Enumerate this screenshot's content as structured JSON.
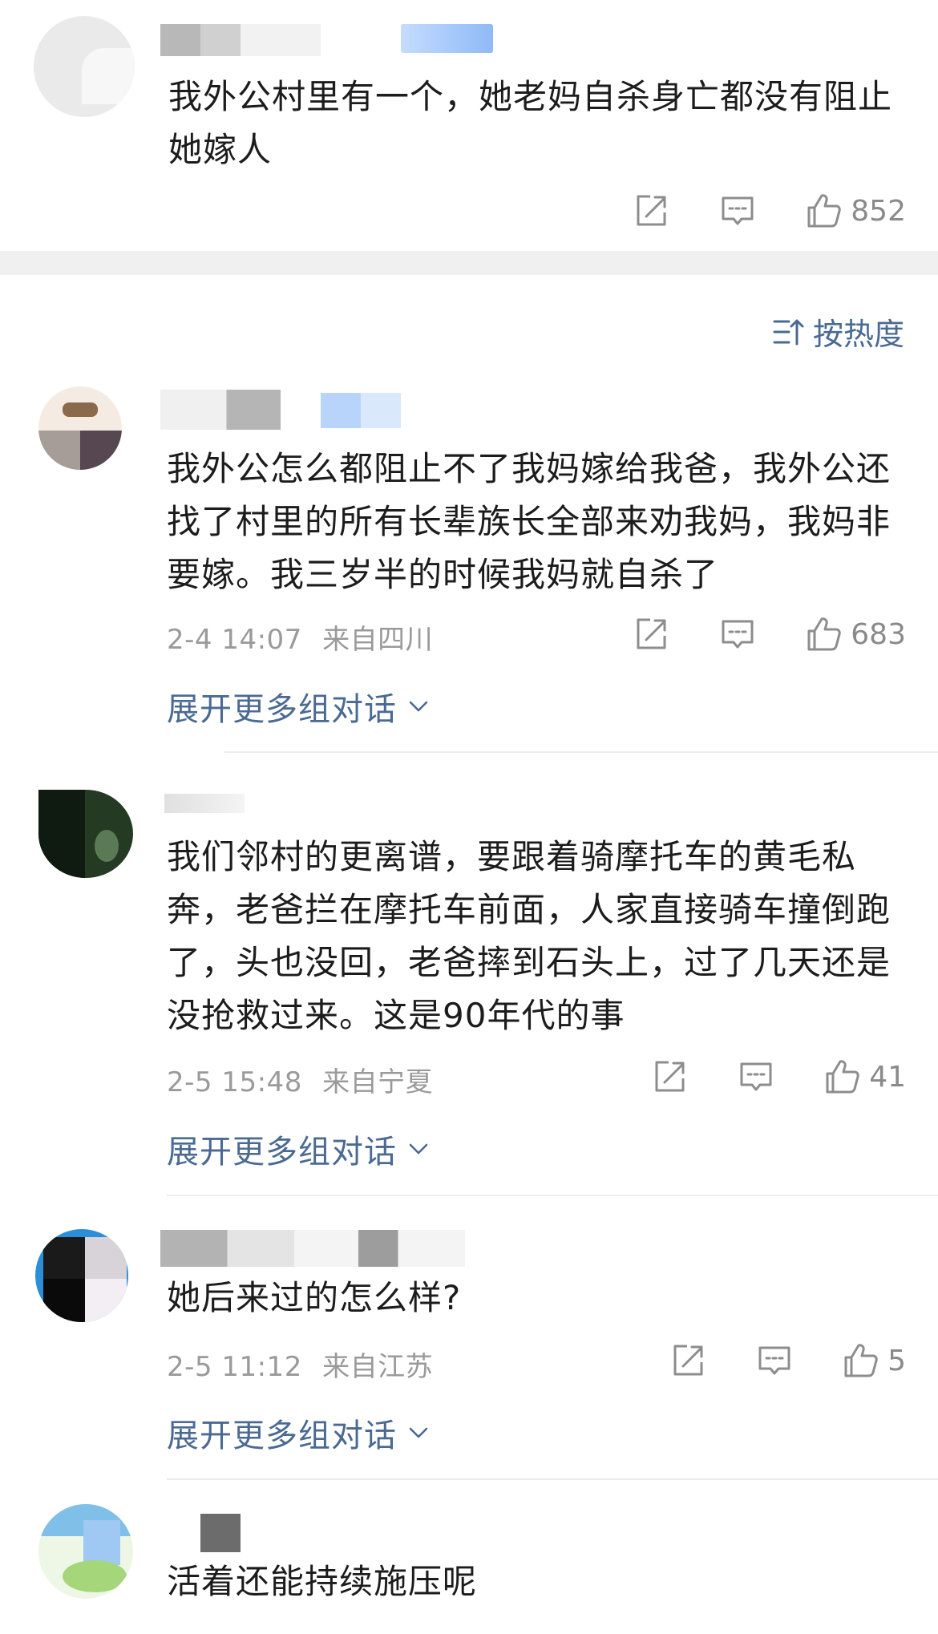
{
  "top_comment": {
    "text": "我外公村里有一个，她老妈自杀身亡都没有阻止她嫁人",
    "likes": "852"
  },
  "sort": {
    "label": "按热度"
  },
  "comments": [
    {
      "text": "我外公怎么都阻止不了我妈嫁给我爸，我外公还找了村里的所有长辈族长全部来劝我妈，我妈非要嫁。我三岁半的时候我妈就自杀了",
      "time": "2-4 14:07",
      "location": "来自四川",
      "likes": "683",
      "expand": "展开更多组对话"
    },
    {
      "text": "我们邻村的更离谱，要跟着骑摩托车的黄毛私奔，老爸拦在摩托车前面，人家直接骑车撞倒跑了，头也没回，老爸摔到石头上，过了几天还是没抢救过来。这是90年代的事",
      "time": "2-5 15:48",
      "location": "来自宁夏",
      "likes": "41",
      "expand": "展开更多组对话"
    },
    {
      "text": "她后来过的怎么样?",
      "time": "2-5 11:12",
      "location": "来自江苏",
      "likes": "5",
      "expand": "展开更多组对话"
    },
    {
      "text": "活着还能持续施压呢"
    }
  ],
  "icons": {
    "share": "share-icon",
    "reply": "reply-icon",
    "like": "thumbs-up-icon",
    "chevron": "chevron-down-icon",
    "sort": "sort-icon"
  },
  "colors": {
    "link": "#4a6a93",
    "meta": "#9a9a9a",
    "text": "#1c1c1c",
    "separator": "#f0f0f0"
  }
}
